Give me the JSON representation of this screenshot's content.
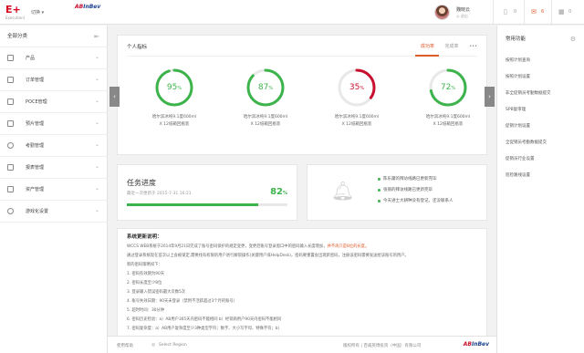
{
  "header": {
    "logo": "E+",
    "logo_sub": "ExecutionI",
    "switch_label": "切换 ▾",
    "brand_a": "AB",
    "brand_b": "InBev",
    "user_name": "魏晓云",
    "logout": "◎ 退出",
    "count_doc": "0",
    "count_msg": "6",
    "count_cal": "0"
  },
  "sidebar": {
    "title": "全部分类",
    "items": [
      {
        "label": "产品"
      },
      {
        "label": "订单管理"
      },
      {
        "label": "POCE管理"
      },
      {
        "label": "预片管理"
      },
      {
        "label": "考勤管理"
      },
      {
        "label": "报表管理"
      },
      {
        "label": "资产管理"
      },
      {
        "label": "游戏化设置"
      }
    ]
  },
  "kpi": {
    "title": "个人指标",
    "tabs": [
      "成功率",
      "完成率"
    ],
    "more": "•••",
    "gauges": [
      {
        "value": 95,
        "unit": "%",
        "color": "#3cb44b",
        "line1": "哈尔滨冰纯9.1度600ml",
        "line2": "X 12纸箱回瓶装"
      },
      {
        "value": 87,
        "unit": "%",
        "color": "#3cb44b",
        "line1": "哈尔滨冰纯9.1度600ml",
        "line2": "X 12纸箱回瓶装"
      },
      {
        "value": 35,
        "unit": "%",
        "color": "#c8102e",
        "line1": "哈尔滨冰纯9.1度600ml",
        "line2": "X 12纸箱回瓶装"
      },
      {
        "value": 72,
        "unit": "%",
        "color": "#3cb44b",
        "line1": "哈尔滨冰纯9.1度600ml",
        "line2": "X 12纸箱回瓶装"
      }
    ]
  },
  "task": {
    "title": "任务进度",
    "time": "最近一次更新于  2015-7-31 16:21",
    "percent": 82,
    "percent_text": "82",
    "unit": "%"
  },
  "notify": {
    "lines": [
      "陈乐黛的拜访线路已更新完毕",
      "张丽的拜访线路已更新完毕",
      "今天进士大耕种没有登记，还没联系人"
    ]
  },
  "description": {
    "title": "系统更新说明：",
    "line1a": "WCCS WEB系统于2014年9月21日完成了账号密码保护的规定变更，变更后账号登录窗口中的密码输入长度增加，",
    "line1b": "并不再只是8位的长度。",
    "line2": "通过登录系统现在首次以上会被锁定,需要找有权限的用户进行解锁操作(关键用户或HelpDesk)，密码要重置会出现新密码，注册该密码需要发送给该账号的用户。",
    "line3": "新的密码策略如下：",
    "rules": [
      "1. 密码有效期为90天",
      "2. 密码长度至少8位",
      "3. 登录输入错误密码最大次数5次",
      "4. 账号失效日期：90天未登录（禁用不活跃超过3个月的账号）",
      "5. 超时时间：30分钟",
      "6. 密码历史检验：a）AB用户365天内密码不能相同  b）经销商用户90天内密码不能相同",
      "7. 密码复杂度：a）AB用户复杂度至少3种类型字符；数字、大小写字母、特殊字符；b）"
    ],
    "last": "经销商用户复杂度1种组合：大小写字母 + 数字"
  },
  "footer": {
    "help": "使用帮助",
    "region": "Select Region",
    "copyright": "版权所有 | 百威英博投资（中国）有限公司",
    "brand_a": "AB",
    "brand_b": "InBev"
  },
  "right_sidebar": {
    "title": "常用功能",
    "items": [
      "按照计划查询",
      "按照计划设置",
      "非全促销员考勤数据提交",
      "SPB复审理",
      "促销计划设置",
      "全促销员考勤数据提交",
      "促销员行业设置",
      "巡检路线设置"
    ]
  },
  "colors": {
    "accent": "#e05a2b",
    "green": "#3cb44b",
    "red": "#c8102e"
  }
}
